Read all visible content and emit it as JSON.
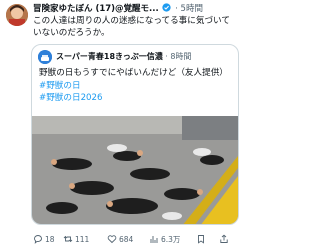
{
  "post": {
    "author_name": "冒険家ゆたぼん (17)@覚醒モ...",
    "time": "· 5時間",
    "text": "この人達は周りの人の迷惑になってる事に気づいていないのだろうか。"
  },
  "quote": {
    "author_name": "スーパー青春18きっぷ一信濃",
    "time": "· 8時間",
    "text": "野獣の日もうすでにやばいんだけど（友人提供）",
    "hashtags": [
      "#野獣の日",
      "#野獣の日2026"
    ]
  },
  "actions": {
    "replies": "18",
    "retweets": "111",
    "likes": "684",
    "views": "6.3万"
  },
  "icons": [
    "verified-badge-icon",
    "reply-icon",
    "retweet-icon",
    "like-icon",
    "views-icon",
    "bookmark-icon",
    "share-icon"
  ],
  "colors": {
    "link": "#1d9bf0",
    "meta": "#536471",
    "border": "#cfd9de",
    "verified": "#1d9bf0",
    "tactile_paving": "#e8c020"
  }
}
